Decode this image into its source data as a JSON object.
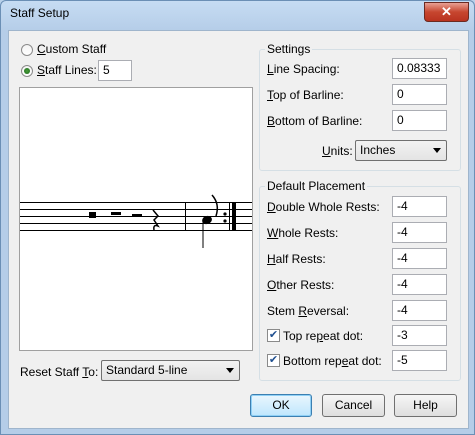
{
  "window": {
    "title": "Staff Setup",
    "close_glyph": "✕"
  },
  "staff_type": {
    "custom_label_u": "C",
    "custom_label_rest": "ustom Staff",
    "lines_label_u": "S",
    "lines_label_rest": "taff Lines:",
    "lines_value": "5",
    "selected": "staff_lines"
  },
  "settings": {
    "legend": "Settings",
    "line_spacing": {
      "label_u": "L",
      "label_rest": "ine Spacing:",
      "value": "0.08333"
    },
    "top_of_barline": {
      "label_u": "T",
      "label_rest": "op of Barline:",
      "value": "0"
    },
    "bottom_of_barline": {
      "label_u": "B",
      "label_rest": "ottom of Barline:",
      "value": "0"
    },
    "units": {
      "label_u": "U",
      "label_rest": "nits:",
      "value": "Inches"
    }
  },
  "default_placement": {
    "legend": "Default Placement",
    "double_whole_rests": {
      "label_u": "D",
      "label_rest": "ouble Whole Rests:",
      "value": "-4"
    },
    "whole_rests": {
      "label_u": "W",
      "label_rest": "hole Rests:",
      "value": "-4"
    },
    "half_rests": {
      "label_u": "H",
      "label_rest": "alf Rests:",
      "value": "-4"
    },
    "other_rests": {
      "label_u": "O",
      "label_rest": "ther Rests:",
      "value": "-4"
    },
    "stem_reversal": {
      "label_pre": "Stem ",
      "label_u": "R",
      "label_rest": "eversal:",
      "value": "-4"
    },
    "top_repeat_dot": {
      "label_pre": "Top re",
      "label_u": "p",
      "label_rest": "eat dot:",
      "value": "-3",
      "checked": true
    },
    "bottom_repeat_dot": {
      "label_pre": "Bottom rep",
      "label_u": "e",
      "label_rest": "at dot:",
      "value": "-5",
      "checked": true
    }
  },
  "reset": {
    "label_pre": "Reset Staff ",
    "label_u": "T",
    "label_rest": "o:",
    "value": "Standard 5-line"
  },
  "buttons": {
    "ok": "OK",
    "cancel": "Cancel",
    "help": "Help"
  }
}
